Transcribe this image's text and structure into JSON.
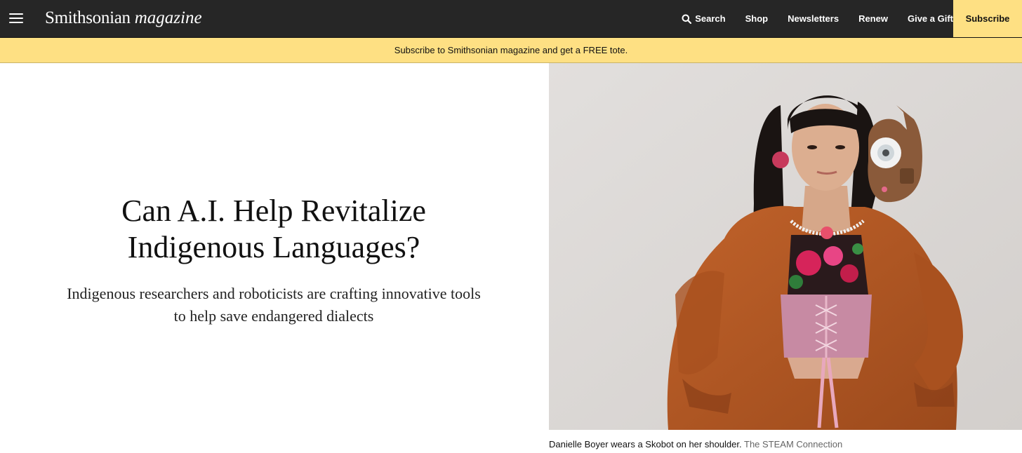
{
  "header": {
    "logo_brand": "Smithsonian",
    "logo_sub": "magazine",
    "nav": {
      "search": "Search",
      "shop": "Shop",
      "newsletters": "Newsletters",
      "renew": "Renew",
      "gift": "Give a Gift"
    },
    "subscribe_label": "Subscribe"
  },
  "promo": {
    "text": "Subscribe to Smithsonian magazine and get a FREE tote."
  },
  "article": {
    "headline_line1": "Can A.I. Help Revitalize",
    "headline_line2": "Indigenous Languages?",
    "dek_line1": "Indigenous researchers and roboticists are crafting innovative tools",
    "dek_line2": "to help save endangered dialects",
    "caption": "Danielle Boyer wears a Skobot on her shoulder.",
    "credit": "The STEAM Connection"
  },
  "colors": {
    "nav_bg": "#262626",
    "accent_yellow": "#fee083"
  },
  "icons": {
    "menu": "menu-icon",
    "search": "search-icon"
  }
}
